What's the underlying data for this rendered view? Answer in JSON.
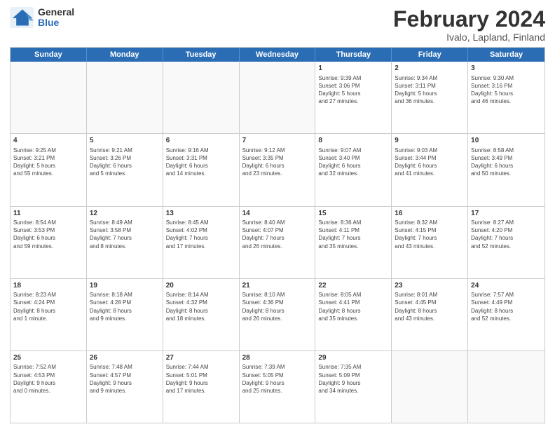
{
  "logo": {
    "general": "General",
    "blue": "Blue"
  },
  "title": "February 2024",
  "subtitle": "Ivalo, Lapland, Finland",
  "weekdays": [
    "Sunday",
    "Monday",
    "Tuesday",
    "Wednesday",
    "Thursday",
    "Friday",
    "Saturday"
  ],
  "weeks": [
    [
      {
        "day": "",
        "info": ""
      },
      {
        "day": "",
        "info": ""
      },
      {
        "day": "",
        "info": ""
      },
      {
        "day": "",
        "info": ""
      },
      {
        "day": "1",
        "info": "Sunrise: 9:39 AM\nSunset: 3:06 PM\nDaylight: 5 hours\nand 27 minutes."
      },
      {
        "day": "2",
        "info": "Sunrise: 9:34 AM\nSunset: 3:11 PM\nDaylight: 5 hours\nand 36 minutes."
      },
      {
        "day": "3",
        "info": "Sunrise: 9:30 AM\nSunset: 3:16 PM\nDaylight: 5 hours\nand 46 minutes."
      }
    ],
    [
      {
        "day": "4",
        "info": "Sunrise: 9:25 AM\nSunset: 3:21 PM\nDaylight: 5 hours\nand 55 minutes."
      },
      {
        "day": "5",
        "info": "Sunrise: 9:21 AM\nSunset: 3:26 PM\nDaylight: 6 hours\nand 5 minutes."
      },
      {
        "day": "6",
        "info": "Sunrise: 9:16 AM\nSunset: 3:31 PM\nDaylight: 6 hours\nand 14 minutes."
      },
      {
        "day": "7",
        "info": "Sunrise: 9:12 AM\nSunset: 3:35 PM\nDaylight: 6 hours\nand 23 minutes."
      },
      {
        "day": "8",
        "info": "Sunrise: 9:07 AM\nSunset: 3:40 PM\nDaylight: 6 hours\nand 32 minutes."
      },
      {
        "day": "9",
        "info": "Sunrise: 9:03 AM\nSunset: 3:44 PM\nDaylight: 6 hours\nand 41 minutes."
      },
      {
        "day": "10",
        "info": "Sunrise: 8:58 AM\nSunset: 3:49 PM\nDaylight: 6 hours\nand 50 minutes."
      }
    ],
    [
      {
        "day": "11",
        "info": "Sunrise: 8:54 AM\nSunset: 3:53 PM\nDaylight: 6 hours\nand 59 minutes."
      },
      {
        "day": "12",
        "info": "Sunrise: 8:49 AM\nSunset: 3:58 PM\nDaylight: 7 hours\nand 8 minutes."
      },
      {
        "day": "13",
        "info": "Sunrise: 8:45 AM\nSunset: 4:02 PM\nDaylight: 7 hours\nand 17 minutes."
      },
      {
        "day": "14",
        "info": "Sunrise: 8:40 AM\nSunset: 4:07 PM\nDaylight: 7 hours\nand 26 minutes."
      },
      {
        "day": "15",
        "info": "Sunrise: 8:36 AM\nSunset: 4:11 PM\nDaylight: 7 hours\nand 35 minutes."
      },
      {
        "day": "16",
        "info": "Sunrise: 8:32 AM\nSunset: 4:15 PM\nDaylight: 7 hours\nand 43 minutes."
      },
      {
        "day": "17",
        "info": "Sunrise: 8:27 AM\nSunset: 4:20 PM\nDaylight: 7 hours\nand 52 minutes."
      }
    ],
    [
      {
        "day": "18",
        "info": "Sunrise: 8:23 AM\nSunset: 4:24 PM\nDaylight: 8 hours\nand 1 minute."
      },
      {
        "day": "19",
        "info": "Sunrise: 8:18 AM\nSunset: 4:28 PM\nDaylight: 8 hours\nand 9 minutes."
      },
      {
        "day": "20",
        "info": "Sunrise: 8:14 AM\nSunset: 4:32 PM\nDaylight: 8 hours\nand 18 minutes."
      },
      {
        "day": "21",
        "info": "Sunrise: 8:10 AM\nSunset: 4:36 PM\nDaylight: 8 hours\nand 26 minutes."
      },
      {
        "day": "22",
        "info": "Sunrise: 8:05 AM\nSunset: 4:41 PM\nDaylight: 8 hours\nand 35 minutes."
      },
      {
        "day": "23",
        "info": "Sunrise: 8:01 AM\nSunset: 4:45 PM\nDaylight: 8 hours\nand 43 minutes."
      },
      {
        "day": "24",
        "info": "Sunrise: 7:57 AM\nSunset: 4:49 PM\nDaylight: 8 hours\nand 52 minutes."
      }
    ],
    [
      {
        "day": "25",
        "info": "Sunrise: 7:52 AM\nSunset: 4:53 PM\nDaylight: 9 hours\nand 0 minutes."
      },
      {
        "day": "26",
        "info": "Sunrise: 7:48 AM\nSunset: 4:57 PM\nDaylight: 9 hours\nand 9 minutes."
      },
      {
        "day": "27",
        "info": "Sunrise: 7:44 AM\nSunset: 5:01 PM\nDaylight: 9 hours\nand 17 minutes."
      },
      {
        "day": "28",
        "info": "Sunrise: 7:39 AM\nSunset: 5:05 PM\nDaylight: 9 hours\nand 25 minutes."
      },
      {
        "day": "29",
        "info": "Sunrise: 7:35 AM\nSunset: 5:09 PM\nDaylight: 9 hours\nand 34 minutes."
      },
      {
        "day": "",
        "info": ""
      },
      {
        "day": "",
        "info": ""
      }
    ]
  ]
}
